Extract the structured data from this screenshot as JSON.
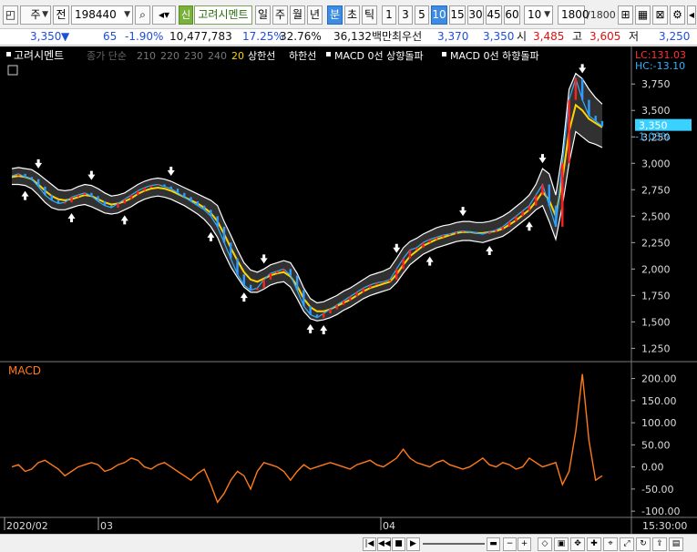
{
  "toolbar": {
    "period_select": "주",
    "prev_label": "전",
    "code_value": "198440",
    "new_badge": "신",
    "stock_name": "고려시멘트",
    "periods": [
      "일",
      "주",
      "월",
      "년",
      "분",
      "초",
      "틱"
    ],
    "selected_period": "분",
    "minutes": [
      "1",
      "3",
      "5",
      "10",
      "15",
      "30",
      "45",
      "60"
    ],
    "selected_minute": "10",
    "interval_value": "10",
    "count_value": "1800",
    "count_total": "/1800"
  },
  "price": {
    "current": "3,350",
    "direction": "▼",
    "change": "65",
    "change_pct": "-1.90%",
    "volume": "10,477,783",
    "volume_ratio": "17.25%",
    "turnover": "32.76%",
    "amount": "36,132백만",
    "best_label": "최우선",
    "best_ask": "3,370",
    "best_bid": "3,350",
    "open_label": "시",
    "open": "3,485",
    "high_label": "고",
    "high": "3,605",
    "low_label": "저",
    "low": "3,250"
  },
  "legend": {
    "name": "고려시멘트",
    "ma_label": "종가 단순",
    "ma_periods": [
      "210",
      "220",
      "230",
      "240"
    ],
    "ma_highlight": "20",
    "upper": "상한선",
    "lower": "하한선",
    "macd_up": "MACD 0선 상향돌파",
    "macd_down": "MACD 0선 하향돌파"
  },
  "axis": {
    "lc": "LC:131.03",
    "hc": "HC:-13.10",
    "price_box": "3,350",
    "price_pct": "-1.03%",
    "macd_title": "MACD",
    "time_end": "15:30:00"
  },
  "chart_data": {
    "type": "line",
    "price_axis": {
      "ylim": [
        1150,
        3950
      ],
      "ticks": [
        "3,750",
        "3,500",
        "3,250",
        "3,000",
        "2,750",
        "2,500",
        "2,250",
        "2,000",
        "1,750",
        "1,500",
        "1,250"
      ]
    },
    "macd_axis": {
      "ylim": [
        -110,
        230
      ],
      "ticks": [
        "200.00",
        "150.00",
        "100.00",
        "50.00",
        "0.00",
        "-50.00",
        "-100.00"
      ]
    },
    "x_ticks": [
      "2020/02",
      "03",
      "04"
    ],
    "price_series": [
      {
        "name": "close",
        "values": [
          2880,
          2900,
          2870,
          2850,
          2780,
          2700,
          2650,
          2620,
          2630,
          2680,
          2700,
          2720,
          2690,
          2640,
          2600,
          2580,
          2620,
          2660,
          2700,
          2740,
          2770,
          2790,
          2800,
          2780,
          2760,
          2720,
          2680,
          2640,
          2600,
          2560,
          2500,
          2400,
          2250,
          2100,
          1950,
          1850,
          1800,
          1820,
          1900,
          1960,
          1980,
          2000,
          1940,
          1800,
          1650,
          1570,
          1540,
          1580,
          1620,
          1660,
          1700,
          1740,
          1780,
          1820,
          1850,
          1870,
          1880,
          1900,
          2000,
          2100,
          2180,
          2200,
          2250,
          2280,
          2300,
          2320,
          2330,
          2350,
          2360,
          2350,
          2340,
          2330,
          2350,
          2370,
          2400,
          2450,
          2500,
          2550,
          2600,
          2700,
          2800,
          2600,
          2400,
          3000,
          3600,
          3800,
          3600,
          3450,
          3400,
          3350
        ]
      },
      {
        "name": "ma20",
        "values": [
          2870,
          2880,
          2870,
          2850,
          2800,
          2740,
          2690,
          2660,
          2650,
          2660,
          2680,
          2700,
          2690,
          2660,
          2630,
          2610,
          2620,
          2640,
          2670,
          2710,
          2740,
          2760,
          2770,
          2760,
          2740,
          2710,
          2680,
          2650,
          2620,
          2580,
          2530,
          2450,
          2330,
          2200,
          2080,
          1970,
          1900,
          1880,
          1910,
          1940,
          1960,
          1970,
          1930,
          1840,
          1720,
          1640,
          1600,
          1600,
          1620,
          1650,
          1680,
          1710,
          1750,
          1790,
          1820,
          1840,
          1860,
          1880,
          1950,
          2040,
          2120,
          2170,
          2220,
          2250,
          2280,
          2300,
          2320,
          2340,
          2350,
          2350,
          2340,
          2340,
          2350,
          2360,
          2380,
          2420,
          2460,
          2510,
          2560,
          2640,
          2730,
          2650,
          2500,
          2850,
          3300,
          3550,
          3500,
          3420,
          3380,
          3340
        ]
      },
      {
        "name": "upper",
        "values": [
          2950,
          2960,
          2950,
          2940,
          2900,
          2850,
          2800,
          2750,
          2740,
          2750,
          2780,
          2800,
          2790,
          2760,
          2720,
          2690,
          2700,
          2720,
          2760,
          2800,
          2830,
          2850,
          2860,
          2850,
          2830,
          2800,
          2770,
          2740,
          2710,
          2680,
          2650,
          2600,
          2450,
          2320,
          2180,
          2060,
          1990,
          1970,
          2000,
          2040,
          2060,
          2080,
          2060,
          1960,
          1820,
          1720,
          1680,
          1690,
          1720,
          1750,
          1790,
          1820,
          1860,
          1900,
          1940,
          1960,
          1980,
          2010,
          2100,
          2200,
          2260,
          2290,
          2330,
          2360,
          2390,
          2410,
          2420,
          2440,
          2450,
          2450,
          2440,
          2440,
          2450,
          2470,
          2500,
          2540,
          2590,
          2640,
          2700,
          2800,
          2950,
          2900,
          2700,
          3100,
          3700,
          3850,
          3800,
          3700,
          3620,
          3560
        ]
      },
      {
        "name": "lower",
        "values": [
          2800,
          2800,
          2790,
          2760,
          2700,
          2630,
          2580,
          2560,
          2560,
          2580,
          2600,
          2610,
          2590,
          2560,
          2530,
          2520,
          2530,
          2560,
          2590,
          2630,
          2660,
          2680,
          2690,
          2680,
          2660,
          2630,
          2600,
          2560,
          2520,
          2470,
          2400,
          2300,
          2150,
          2020,
          1920,
          1830,
          1780,
          1780,
          1810,
          1850,
          1870,
          1880,
          1830,
          1720,
          1600,
          1530,
          1510,
          1520,
          1540,
          1570,
          1610,
          1640,
          1680,
          1720,
          1750,
          1770,
          1790,
          1810,
          1870,
          1960,
          2040,
          2090,
          2140,
          2170,
          2200,
          2220,
          2240,
          2260,
          2270,
          2270,
          2260,
          2250,
          2270,
          2290,
          2310,
          2350,
          2400,
          2450,
          2500,
          2560,
          2600,
          2450,
          2280,
          2600,
          3000,
          3300,
          3250,
          3200,
          3180,
          3150
        ]
      }
    ],
    "macd_values": [
      0,
      5,
      -10,
      -5,
      10,
      15,
      5,
      -5,
      -20,
      -10,
      0,
      5,
      10,
      5,
      -10,
      -5,
      5,
      10,
      20,
      15,
      0,
      -5,
      5,
      10,
      0,
      -10,
      -20,
      -30,
      -15,
      -5,
      -40,
      -80,
      -60,
      -30,
      -10,
      -20,
      -50,
      -10,
      10,
      5,
      0,
      -10,
      -30,
      -10,
      5,
      -5,
      0,
      5,
      10,
      5,
      0,
      -5,
      5,
      10,
      15,
      5,
      0,
      10,
      20,
      40,
      20,
      10,
      5,
      0,
      10,
      15,
      5,
      0,
      -5,
      0,
      10,
      20,
      5,
      0,
      10,
      5,
      -5,
      0,
      20,
      10,
      0,
      5,
      10,
      -40,
      -10,
      80,
      210,
      60,
      -30,
      -20
    ]
  }
}
